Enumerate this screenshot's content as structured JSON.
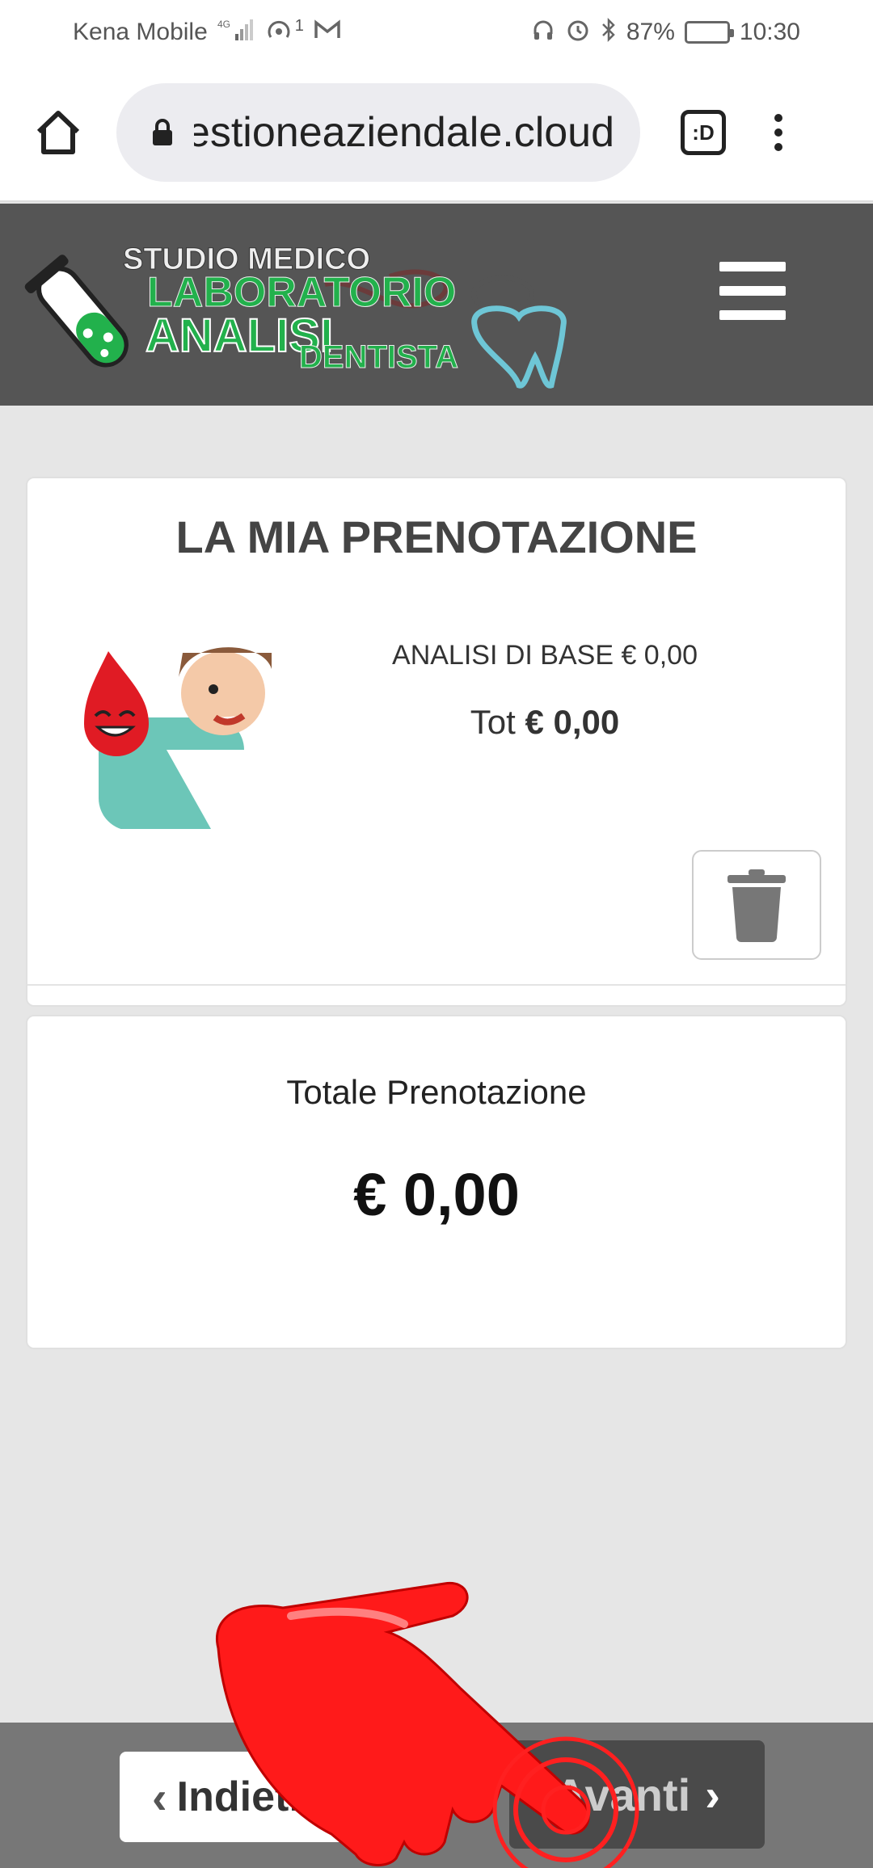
{
  "status_bar": {
    "carrier": "Kena Mobile",
    "network": "4G",
    "notification_count": "1",
    "battery": "87%",
    "battery_level": 0.87,
    "time": "10:30"
  },
  "browser": {
    "url": "gestioneaziendale.cloud",
    "tab_label": ":D"
  },
  "header": {
    "logo": {
      "line1": "STUDIO MEDICO",
      "line2": "LABORATORIO",
      "line3": "ANALISI",
      "line4": "DENTISTA"
    }
  },
  "booking": {
    "title": "LA MIA PRENOTAZIONE",
    "item": "ANALISI DI BASE € 0,00",
    "tot_label": "Tot",
    "tot_value": "€ 0,00"
  },
  "summary": {
    "label": "Totale Prenotazione",
    "value": "€ 0,00"
  },
  "nav": {
    "back_label": "Indietro",
    "next_label": "Avanti"
  },
  "colors": {
    "header_bg": "#555555",
    "page_bg": "#e6e6e6",
    "bottom_bar": "#777777",
    "hand_red": "#ff1a1a",
    "logo_green": "#22b14c"
  }
}
